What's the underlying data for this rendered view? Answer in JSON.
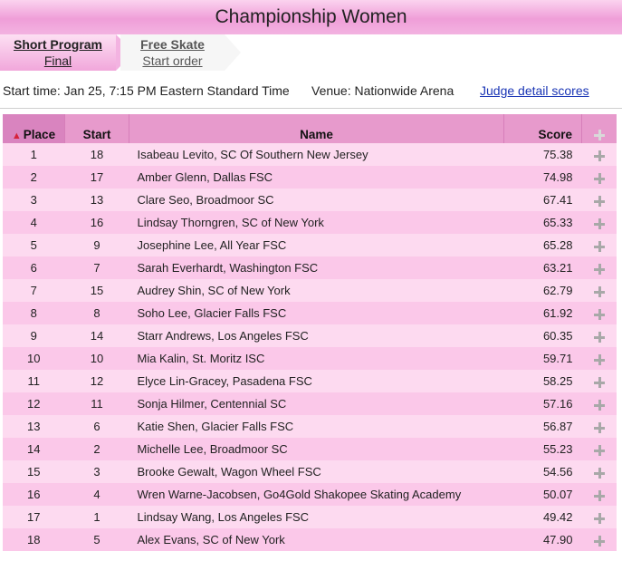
{
  "title": "Championship Women",
  "tabs": [
    {
      "label": "Short Program",
      "sub": "Final"
    },
    {
      "label": "Free Skate",
      "sub": "Start order"
    }
  ],
  "info": {
    "start_time": "Start time: Jan 25, 7:15 PM Eastern Standard Time",
    "venue": "Venue: Nationwide Arena",
    "judge_link": "Judge detail scores"
  },
  "table": {
    "headers": {
      "place": "Place",
      "start": "Start",
      "name": "Name",
      "score": "Score"
    },
    "rows": [
      {
        "place": "1",
        "start": "18",
        "name": "Isabeau Levito, SC Of Southern New Jersey",
        "score": "75.38"
      },
      {
        "place": "2",
        "start": "17",
        "name": "Amber Glenn, Dallas FSC",
        "score": "74.98"
      },
      {
        "place": "3",
        "start": "13",
        "name": "Clare Seo, Broadmoor SC",
        "score": "67.41"
      },
      {
        "place": "4",
        "start": "16",
        "name": "Lindsay Thorngren, SC of New York",
        "score": "65.33"
      },
      {
        "place": "5",
        "start": "9",
        "name": "Josephine Lee, All Year FSC",
        "score": "65.28"
      },
      {
        "place": "6",
        "start": "7",
        "name": "Sarah Everhardt, Washington FSC",
        "score": "63.21"
      },
      {
        "place": "7",
        "start": "15",
        "name": "Audrey Shin, SC of New York",
        "score": "62.79"
      },
      {
        "place": "8",
        "start": "8",
        "name": "Soho Lee, Glacier Falls FSC",
        "score": "61.92"
      },
      {
        "place": "9",
        "start": "14",
        "name": "Starr Andrews, Los Angeles FSC",
        "score": "60.35"
      },
      {
        "place": "10",
        "start": "10",
        "name": "Mia Kalin, St. Moritz ISC",
        "score": "59.71"
      },
      {
        "place": "11",
        "start": "12",
        "name": "Elyce Lin-Gracey, Pasadena FSC",
        "score": "58.25"
      },
      {
        "place": "12",
        "start": "11",
        "name": "Sonja Hilmer, Centennial SC",
        "score": "57.16"
      },
      {
        "place": "13",
        "start": "6",
        "name": "Katie Shen, Glacier Falls FSC",
        "score": "56.87"
      },
      {
        "place": "14",
        "start": "2",
        "name": "Michelle Lee, Broadmoor SC",
        "score": "55.23"
      },
      {
        "place": "15",
        "start": "3",
        "name": "Brooke Gewalt, Wagon Wheel FSC",
        "score": "54.56"
      },
      {
        "place": "16",
        "start": "4",
        "name": "Wren Warne-Jacobsen, Go4Gold Shakopee Skating Academy",
        "score": "50.07"
      },
      {
        "place": "17",
        "start": "1",
        "name": "Lindsay Wang, Los Angeles FSC",
        "score": "49.42"
      },
      {
        "place": "18",
        "start": "5",
        "name": "Alex Evans, SC of New York",
        "score": "47.90"
      }
    ]
  },
  "icons": {
    "sort": "sort-up-icon",
    "expand": "plus-icon"
  },
  "colors": {
    "header_pink": "#e79acc",
    "row_light": "#fddaf0",
    "row_dark": "#fbc8e9",
    "link": "#1a35b5"
  }
}
